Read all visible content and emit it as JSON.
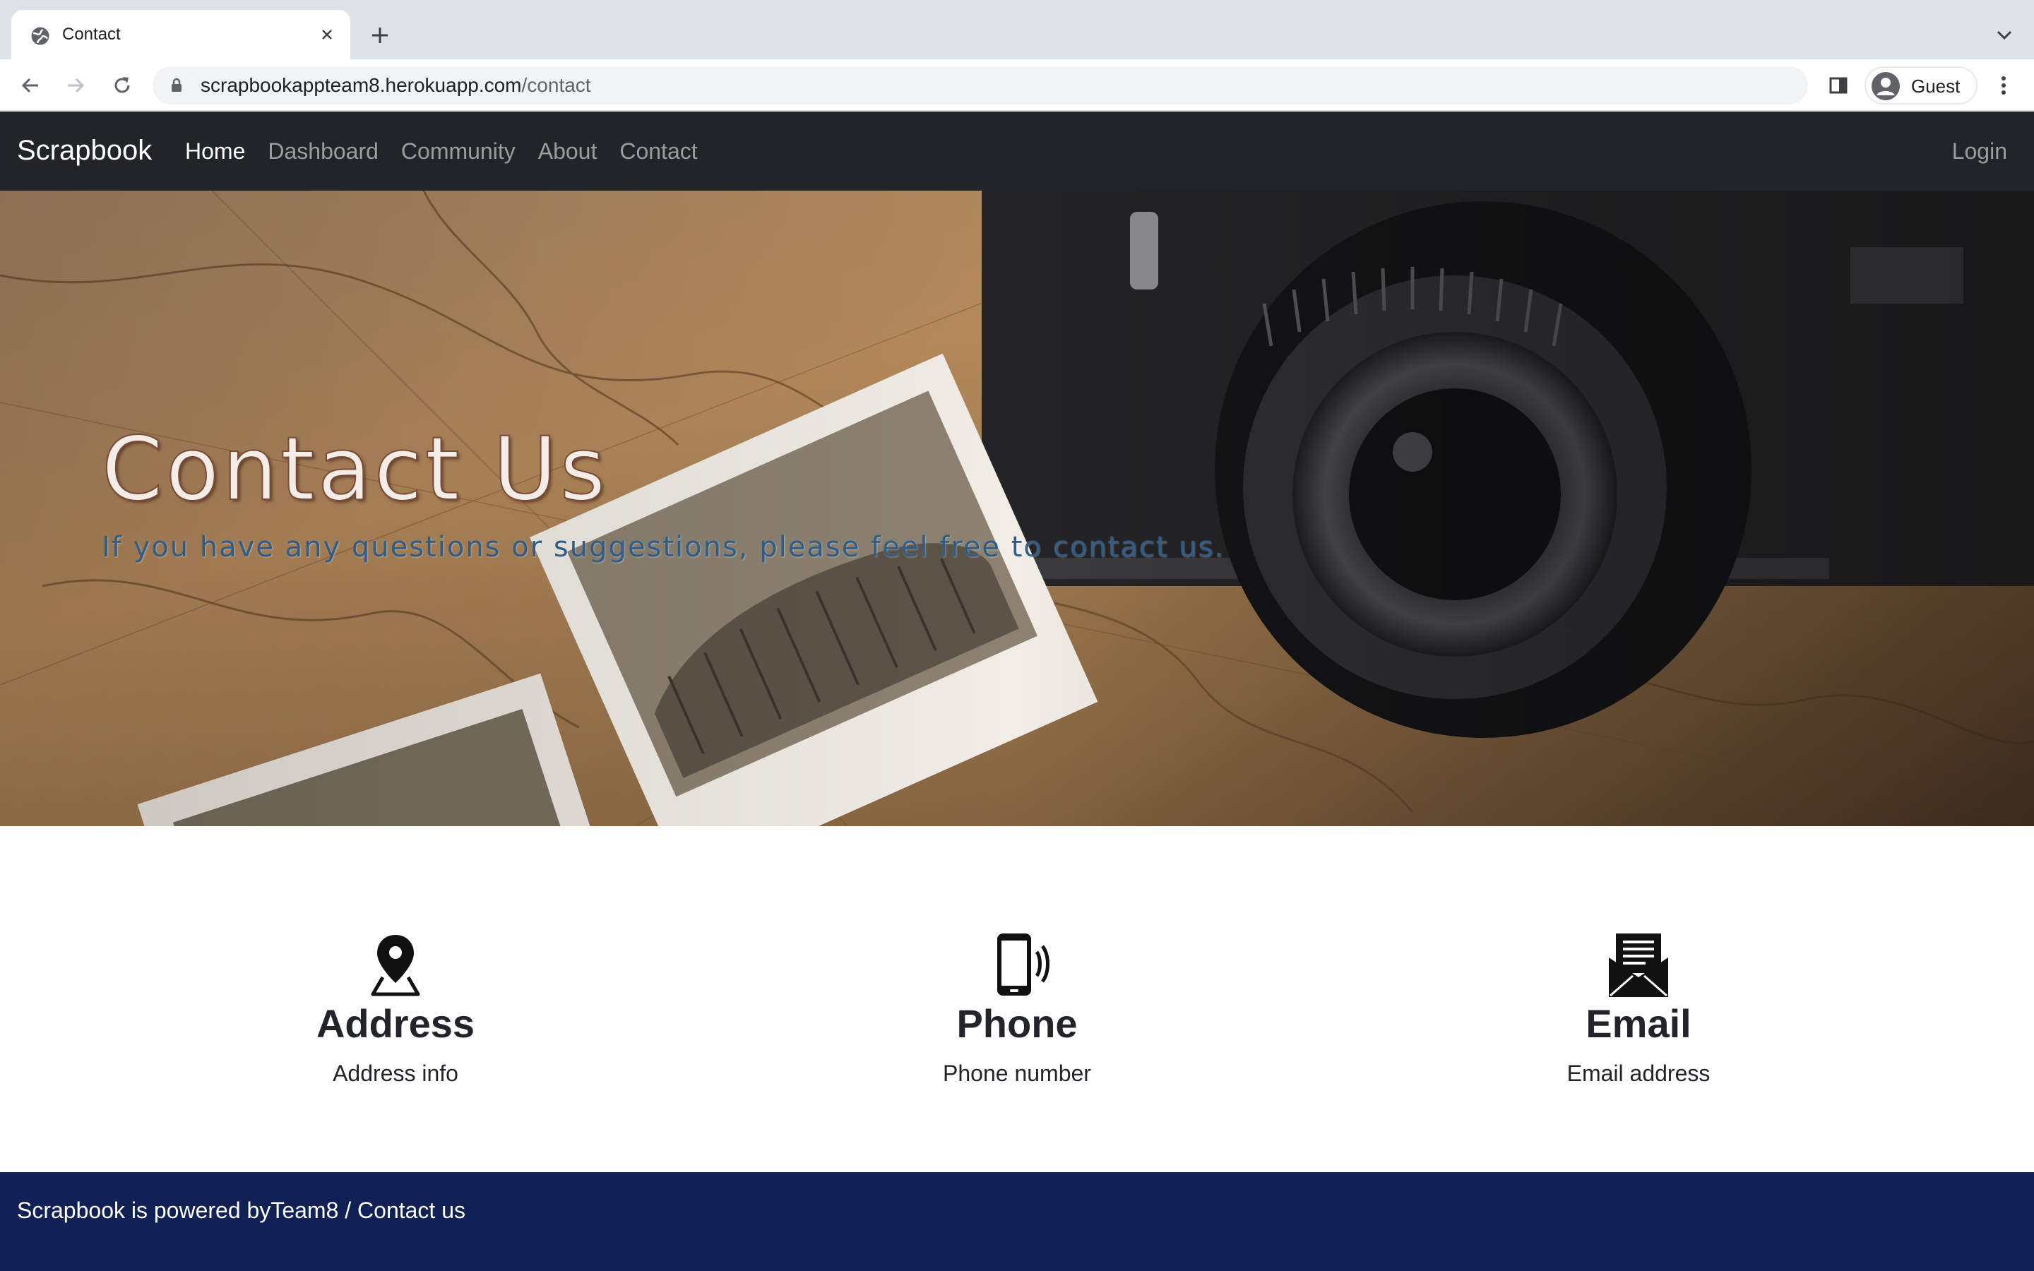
{
  "browser": {
    "tab_title": "Contact",
    "url_domain": "scrapbookappteam8.herokuapp.com",
    "url_path": "/contact",
    "profile_label": "Guest"
  },
  "navbar": {
    "brand": "Scrapbook",
    "links": [
      {
        "label": "Home",
        "active": true
      },
      {
        "label": "Dashboard",
        "active": false
      },
      {
        "label": "Community",
        "active": false
      },
      {
        "label": "About",
        "active": false
      },
      {
        "label": "Contact",
        "active": false
      }
    ],
    "login": "Login"
  },
  "hero": {
    "title": "Contact Us",
    "subtitle": "If you have any questions or suggestions, please feel free to contact us."
  },
  "cards": [
    {
      "icon": "map-pin-icon",
      "title": "Address",
      "text": "Address info"
    },
    {
      "icon": "mobile-phone-icon",
      "title": "Phone",
      "text": "Phone number"
    },
    {
      "icon": "envelope-icon",
      "title": "Email",
      "text": "Email address"
    }
  ],
  "footer": {
    "prefix": "Scrapbook is powered by",
    "team": "Team8",
    "separator": " / ",
    "contact_link": "Contact us"
  },
  "colors": {
    "navbar_bg": "#212529",
    "footer_bg": "#112155",
    "subtitle": "#2f5d87"
  }
}
